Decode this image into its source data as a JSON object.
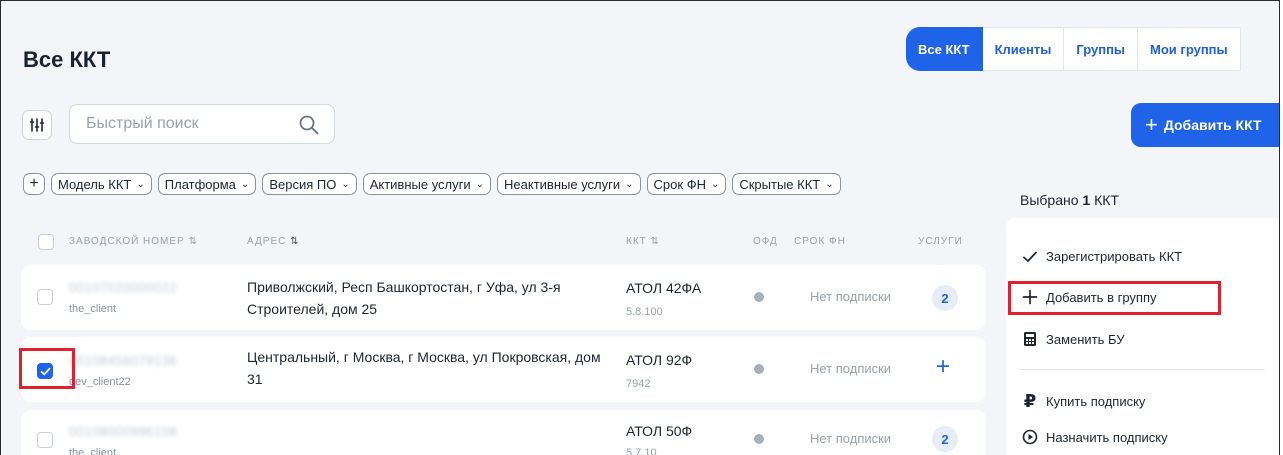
{
  "header": {
    "title": "Все ККТ"
  },
  "tabs": [
    {
      "label": "Все ККТ",
      "active": true
    },
    {
      "label": "Клиенты",
      "active": false
    },
    {
      "label": "Группы",
      "active": false
    },
    {
      "label": "Мои группы",
      "active": false
    }
  ],
  "search": {
    "placeholder": "Быстрый поиск"
  },
  "add_kkt_button": {
    "label": "Добавить ККТ"
  },
  "filters": [
    "Модель ККТ",
    "Платформа",
    "Версия ПО",
    "Активные услуги",
    "Неактивные услуги",
    "Срок ФН",
    "Скрытые ККТ"
  ],
  "table": {
    "headers": {
      "serial": "ЗАВОДСКОЙ НОМЕР",
      "address": "АДРЕС",
      "kkt": "ККТ",
      "ofd": "ОФД",
      "fn": "СРОК ФН",
      "services": "УСЛУГИ"
    },
    "rows": [
      {
        "serial": "00107020000022",
        "client": "the_client",
        "address": "Приволжский, Респ Башкортостан, г Уфа, ул 3-я Строителей, дом 25",
        "model": "АТОЛ 42ФА",
        "version": "5.8.100",
        "subscription": "Нет подписки",
        "services": "2",
        "checked": false
      },
      {
        "serial": "00108456079136",
        "client": "dev_client22",
        "address": "Центральный, г Москва, г Москва, ул Покровская, дом 31",
        "model": "АТОЛ 92Ф",
        "version": "7942",
        "subscription": "Нет подписки",
        "services": "+",
        "checked": true
      },
      {
        "serial": "00108000996108",
        "client": "the_client",
        "address": "",
        "model": "АТОЛ 50Ф",
        "version": "5.7.10",
        "subscription": "Нет подписки",
        "services": "2",
        "checked": false
      }
    ]
  },
  "selection": {
    "prefix": "Выбрано",
    "count": "1",
    "suffix": "ККТ"
  },
  "actions": [
    {
      "label": "Зарегистрировать ККТ",
      "icon": "check-icon"
    },
    {
      "label": "Добавить в группу",
      "icon": "plus-icon"
    },
    {
      "label": "Заменить БУ",
      "icon": "cash-register-icon"
    },
    {
      "label": "Купить подписку",
      "icon": "ruble-icon"
    },
    {
      "label": "Назначить подписку",
      "icon": "play-circle-icon"
    }
  ],
  "colors": {
    "accent": "#1e63e8",
    "highlight": "#e0202f",
    "background": "#f4f5f8"
  }
}
